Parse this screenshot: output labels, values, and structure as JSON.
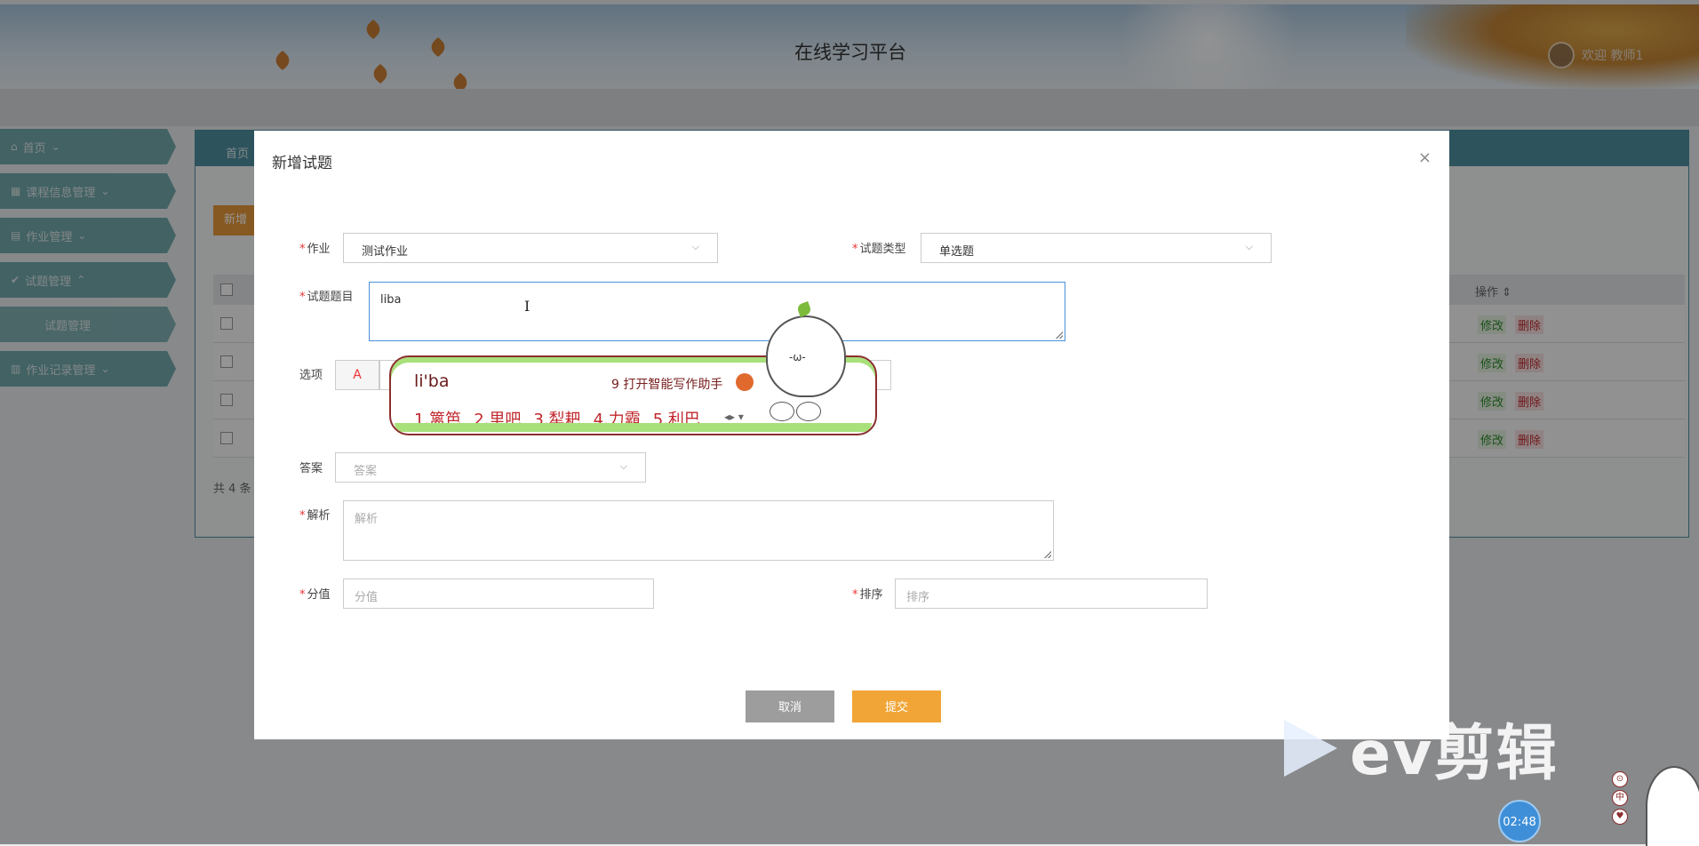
{
  "header": {
    "title": "在线学习平台",
    "welcome": "欢迎 教师1"
  },
  "sidebar": {
    "items": [
      {
        "label": "首页",
        "icon": "home-icon"
      },
      {
        "label": "课程信息管理",
        "icon": "grid-icon"
      },
      {
        "label": "作业管理",
        "icon": "folder-icon"
      },
      {
        "label": "试题管理",
        "icon": "check-circle-icon"
      },
      {
        "label": "试题管理",
        "icon": ""
      },
      {
        "label": "作业记录管理",
        "icon": "book-icon"
      }
    ]
  },
  "panel": {
    "tab": "首页",
    "add_button": "新增",
    "column_op": "操作",
    "rows": [
      {
        "edit": "修改",
        "delete": "删除"
      },
      {
        "edit": "修改",
        "delete": "删除"
      },
      {
        "edit": "修改",
        "delete": "删除"
      },
      {
        "edit": "修改",
        "delete": "删除"
      }
    ],
    "count": "共 4 条"
  },
  "modal": {
    "title": "新增试题",
    "close": "×",
    "fields": {
      "homework": {
        "label": "作业",
        "value": "测试作业"
      },
      "type": {
        "label": "试题类型",
        "value": "单选题"
      },
      "question": {
        "label": "试题题目",
        "value": "liba"
      },
      "options": {
        "label": "选项",
        "first": "A"
      },
      "answer": {
        "label": "答案",
        "placeholder": "答案"
      },
      "analysis": {
        "label": "解析",
        "placeholder": "解析"
      },
      "score": {
        "label": "分值",
        "placeholder": "分值"
      },
      "order": {
        "label": "排序",
        "placeholder": "排序"
      }
    },
    "buttons": {
      "cancel": "取消",
      "submit": "提交"
    }
  },
  "ime": {
    "pinyin": "li'ba",
    "assist": "9 打开智能写作助手",
    "candidates": [
      "1.篱笆",
      "2.里吧",
      "3.犁耙",
      "4.力霸",
      "5.利巴"
    ]
  },
  "watermark": {
    "text": "ev剪辑"
  },
  "timer": "02:48",
  "tools": [
    "⊙",
    "中",
    "♥"
  ]
}
